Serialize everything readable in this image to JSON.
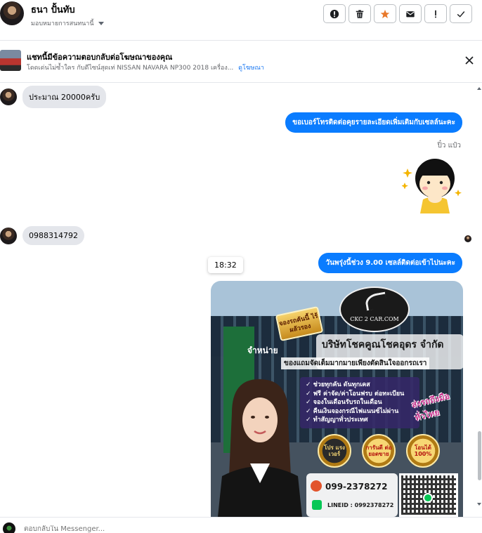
{
  "header": {
    "contact_name": "ธนา ปั้นทับ",
    "assign_label": "มอบหมายการสนทนานี้",
    "actions": [
      {
        "name": "spam-button",
        "icon": "alert-circle-icon"
      },
      {
        "name": "delete-button",
        "icon": "trash-icon"
      },
      {
        "name": "star-button",
        "icon": "star-icon",
        "color": "#e8782a"
      },
      {
        "name": "mark-unread-button",
        "icon": "envelope-icon"
      },
      {
        "name": "follow-up-button",
        "icon": "exclamation-icon"
      },
      {
        "name": "done-button",
        "icon": "check-icon"
      }
    ]
  },
  "ad_banner": {
    "title": "แชทนี้มีข้อความตอบกลับต่อโฆษณาของคุณ",
    "subtitle": "โดดเด่นไม่ซ้ำใคร กับดีไซน์สุดเท่ NISSAN NAVARA NP300 2018 เครื่อง...",
    "link": "ดูโฆษณา"
  },
  "messages": [
    {
      "direction": "in",
      "text": "ประมาณ 20000ครับ"
    },
    {
      "direction": "out",
      "text": "ขอเบอร์โทรติดต่อคุยรายละเอียดเพิ่มเติมกับเซลล์นะคะ"
    },
    {
      "direction": "out",
      "type": "sticker",
      "sender": "ปิ๋ว แป๋ว"
    },
    {
      "direction": "in",
      "text": "0988314792"
    },
    {
      "direction": "out",
      "text": "วันพรุ่งนี้ช่วง 9.00 เซลล์ติดต่อเข้าไปนะคะ",
      "tooltip_time": "18:32"
    }
  ],
  "ad_image": {
    "brand": "CKC 2 CAR.COM",
    "badge": "จองรถคันนี้ ไร้ผลัวรอง",
    "distributor": "จำหน่าย",
    "company": "บริษัทโชคคูณโชคอุดร จำกัด",
    "tagline": "ของแถมจัดเต็มมากมายเพียงตัดสินใจออกรถเรา",
    "bullets": [
      "ช่วยทุกคัน ดันทุกเคส",
      "ฟรี ค่าจัด/ค่าโอนฟรบ ต่อทะเบียน",
      "จองในเดือนรับรถในเดือน",
      "คืนเงินจองกรณีไฟแนนซ์ไม่ผ่าน",
      "ทำสัญญาทั่วประเทศ"
    ],
    "script_text": "ส่งรถถึงมือ ทั่วไทย",
    "coins": [
      "โปร แรง เวอร์",
      "การันตี ต่อ ยอดขาย",
      "โอนได้ 100%"
    ],
    "phone": "099-2378272",
    "line_id": "LINEID : 0992378272"
  },
  "composer": {
    "placeholder": "ตอบกลับใน Messenger..."
  }
}
